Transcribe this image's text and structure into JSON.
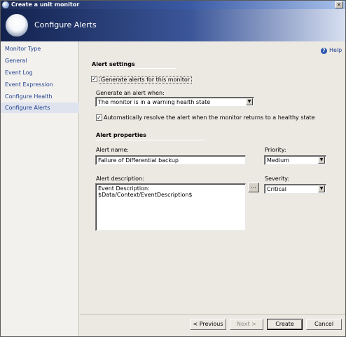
{
  "window": {
    "title": "Create a unit monitor",
    "close_glyph": "×"
  },
  "banner": {
    "heading": "Configure Alerts"
  },
  "nav": {
    "items": [
      {
        "label": "Monitor Type"
      },
      {
        "label": "General"
      },
      {
        "label": "Event Log"
      },
      {
        "label": "Event Expression"
      },
      {
        "label": "Configure Health"
      },
      {
        "label": "Configure Alerts",
        "selected": true
      }
    ]
  },
  "help": {
    "label": "Help",
    "icon": "?"
  },
  "alert_settings": {
    "title": "Alert settings",
    "generate_alerts": {
      "label": "Generate alerts for this monitor",
      "checked": true,
      "mark": "✓"
    },
    "generate_when": {
      "label": "Generate an alert when:",
      "value": "The monitor is in a warning health state"
    },
    "auto_resolve": {
      "label": "Automatically resolve the alert when the monitor returns to a healthy state",
      "checked": true,
      "mark": "✓"
    }
  },
  "alert_properties": {
    "title": "Alert properties",
    "alert_name": {
      "label": "Alert name:",
      "value": "Failure of Differential backup"
    },
    "priority": {
      "label": "Priority:",
      "value": "Medium"
    },
    "alert_description": {
      "label": "Alert description:",
      "value": "Event Description: $Data/Context/EventDescription$"
    },
    "severity": {
      "label": "Severity:",
      "value": "Critical"
    },
    "ellipsis_label": "..."
  },
  "footer": {
    "previous": "< Previous",
    "next": "Next >",
    "create": "Create",
    "cancel": "Cancel"
  },
  "dropdown_arrow": "▼"
}
